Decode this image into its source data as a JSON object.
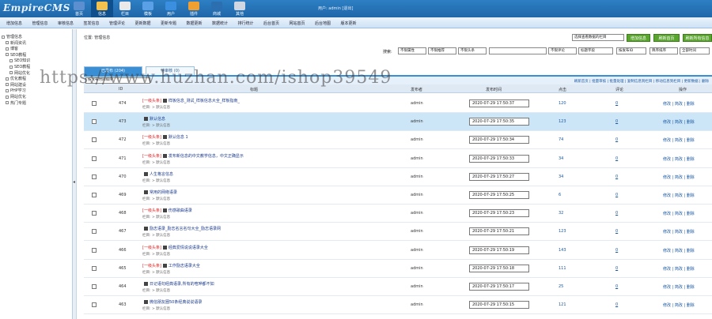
{
  "app": {
    "logo": "EmpireCMS",
    "user_info": "用户: admin [退出]"
  },
  "top_nav": [
    {
      "label": "首页",
      "icon": "home-icon",
      "color": "#5b8fd0"
    },
    {
      "label": "信息",
      "icon": "edit-icon",
      "color": "#f2c14e"
    },
    {
      "label": "栏目",
      "icon": "folder-icon",
      "color": "#e9e9e9"
    },
    {
      "label": "模板",
      "icon": "template-icon",
      "color": "#5aa0e6"
    },
    {
      "label": "用户",
      "icon": "user-icon",
      "color": "#3b8fe0"
    },
    {
      "label": "插件",
      "icon": "plugin-icon",
      "color": "#f0a030"
    },
    {
      "label": "商城",
      "icon": "shop-icon",
      "color": "#2c6fb0"
    },
    {
      "label": "其他",
      "icon": "gear-icon",
      "color": "#cfd8e2"
    }
  ],
  "sub_nav": [
    "增加信息",
    "管理信息",
    "审核信息",
    "签发信息",
    "管理评论",
    "更新数据",
    "更新专题",
    "数据更新",
    "数据统计",
    "排行统计",
    "后台首页",
    "网站首页",
    "后台地图",
    "版本更新"
  ],
  "sidebar": [
    {
      "label": "管理信息",
      "indent": 0
    },
    {
      "label": "新闻资讯",
      "indent": 1
    },
    {
      "label": "博客",
      "indent": 1
    },
    {
      "label": "SEO教程",
      "indent": 1
    },
    {
      "label": "SEO知识",
      "indent": 2
    },
    {
      "label": "SEO教程",
      "indent": 2
    },
    {
      "label": "网站优化",
      "indent": 2
    },
    {
      "label": "优化教程",
      "indent": 1
    },
    {
      "label": "网站建设",
      "indent": 1
    },
    {
      "label": "PHP学习",
      "indent": 1
    },
    {
      "label": "网站优化",
      "indent": 1
    },
    {
      "label": "热门专题",
      "indent": 1
    }
  ],
  "main": {
    "location": "位置: 管理信息",
    "view_select": "选择查看数据的栏目",
    "buttons": [
      "增加信息",
      "刷新首页",
      "刷新所有信息"
    ],
    "search": {
      "label": "搜索:",
      "selects": [
        "不限属性",
        "不限推荐",
        "不限头条"
      ],
      "selects2": [
        "不限评论",
        "标题字段",
        "按发布ID",
        "降序排序",
        "全部时间"
      ]
    },
    "tabs": [
      {
        "label": "已发布 (204)"
      },
      {
        "label": "待审核 (0)"
      }
    ],
    "sort_select": "按发布时间排序",
    "toolbar_links": "刷新首页 | 批量审核 | 批量处理 | 复制信息到栏目 | 移动信息到栏目 | 更新数据 | 删除",
    "headers": [
      "ID",
      "标题",
      "发布者",
      "发布时间",
      "点击",
      "评论",
      "操作"
    ],
    "rows": [
      {
        "id": "474",
        "badge": "[一级头条]",
        "title": "样板信息_测试_样板信息大全_样板指南_",
        "category": "栏目: > 默认信息",
        "publisher": "admin",
        "date": "2020-07-29 17:50:37",
        "views": "120",
        "comments": "0",
        "hl": false
      },
      {
        "id": "473",
        "badge": "",
        "title": "默认信息",
        "category": "栏目: > 默认信息",
        "publisher": "admin",
        "date": "2020-07-29 17:50:35",
        "views": "123",
        "comments": "0",
        "hl": true
      },
      {
        "id": "472",
        "badge": "[一级头条]",
        "title": "默认信息 1",
        "category": "栏目: > 默认信息",
        "publisher": "admin",
        "date": "2020-07-29 17:50:34",
        "views": "74",
        "comments": "0",
        "hl": false
      },
      {
        "id": "471",
        "badge": "[一级头条]",
        "title": "发布新信息的中文教学信息，中文正确显示",
        "category": "栏目: > 默认信息",
        "publisher": "admin",
        "date": "2020-07-29 17:50:33",
        "views": "34",
        "comments": "0",
        "hl": false
      },
      {
        "id": "470",
        "badge": "",
        "title": "人生格言信息",
        "category": "栏目: > 默认信息",
        "publisher": "admin",
        "date": "2020-07-29 17:50:27",
        "views": "34",
        "comments": "0",
        "hl": false
      },
      {
        "id": "469",
        "badge": "",
        "title": "常用的网络语录",
        "category": "栏目: > 默认信息",
        "publisher": "admin",
        "date": "2020-07-29 17:50:25",
        "views": "6",
        "comments": "0",
        "hl": false
      },
      {
        "id": "468",
        "badge": "[一级头条]",
        "title": "伤感歌曲语录",
        "category": "栏目: > 默认信息",
        "publisher": "admin",
        "date": "2020-07-29 17:50:23",
        "views": "32",
        "comments": "0",
        "hl": false
      },
      {
        "id": "467",
        "badge": "",
        "title": "励志语录_励志名言名句大全_励志语录网",
        "category": "栏目: > 默认信息",
        "publisher": "admin",
        "date": "2020-07-29 17:50:21",
        "views": "123",
        "comments": "0",
        "hl": false
      },
      {
        "id": "466",
        "badge": "[一级头条]",
        "title": "经典爱情说说语录大全",
        "category": "栏目: > 默认信息",
        "publisher": "admin",
        "date": "2020-07-29 17:50:19",
        "views": "143",
        "comments": "0",
        "hl": false
      },
      {
        "id": "465",
        "badge": "[一级头条]",
        "title": "工作励志语录大全",
        "category": "栏目: > 默认信息",
        "publisher": "admin",
        "date": "2020-07-29 17:50:18",
        "views": "111",
        "comments": "0",
        "hl": false
      },
      {
        "id": "464",
        "badge": "",
        "title": "日记语句经典语录,所有的喧哗都不如",
        "category": "栏目: > 默认信息",
        "publisher": "admin",
        "date": "2020-07-29 17:50:17",
        "views": "25",
        "comments": "0",
        "hl": false
      },
      {
        "id": "463",
        "badge": "",
        "title": "微信朋友圈50条经典说说语录",
        "category": "栏目: > 默认信息",
        "publisher": "admin",
        "date": "2020-07-29 17:50:15",
        "views": "121",
        "comments": "0",
        "hl": false
      }
    ],
    "row_ops": "修改 | 简改 | 删除"
  },
  "watermark": "https://www.huzhan.com/ishop39549"
}
